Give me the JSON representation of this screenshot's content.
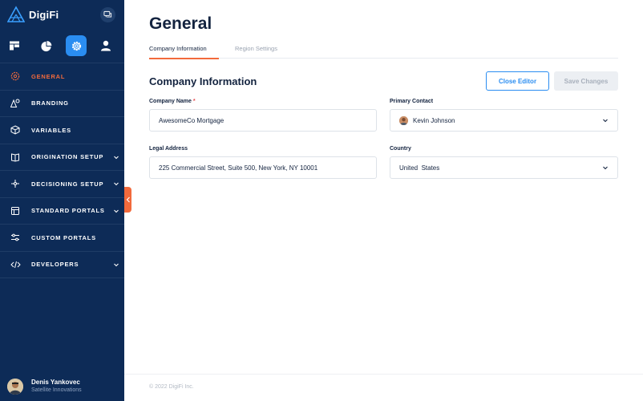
{
  "brand": {
    "name": "DigiFi"
  },
  "sidebar": {
    "topnav": [
      {
        "icon": "board-icon",
        "active": false
      },
      {
        "icon": "pie-chart-icon",
        "active": false
      },
      {
        "icon": "gear-icon",
        "active": true
      },
      {
        "icon": "user-icon",
        "active": false
      }
    ],
    "items": [
      {
        "label": "GENERAL",
        "icon": "gear-icon",
        "active": true,
        "expandable": false
      },
      {
        "label": "BRANDING",
        "icon": "shapes-icon",
        "active": false,
        "expandable": false
      },
      {
        "label": "VARIABLES",
        "icon": "cube-icon",
        "active": false,
        "expandable": false
      },
      {
        "label": "ORIGINATION SETUP",
        "icon": "book-icon",
        "active": false,
        "expandable": true
      },
      {
        "label": "DECISIONING SETUP",
        "icon": "flow-icon",
        "active": false,
        "expandable": true
      },
      {
        "label": "STANDARD PORTALS",
        "icon": "layout-icon",
        "active": false,
        "expandable": true
      },
      {
        "label": "CUSTOM PORTALS",
        "icon": "sliders-icon",
        "active": false,
        "expandable": false
      },
      {
        "label": "DEVELOPERS",
        "icon": "code-icon",
        "active": false,
        "expandable": true
      }
    ]
  },
  "user": {
    "name": "Denis Yankovec",
    "org": "Satellite Innovations"
  },
  "page": {
    "title": "General"
  },
  "tabs": [
    {
      "label": "Company Information",
      "active": true
    },
    {
      "label": "Region Settings",
      "active": false
    }
  ],
  "section": {
    "title": "Company Information",
    "close_label": "Close Editor",
    "save_label": "Save Changes"
  },
  "form": {
    "company_name": {
      "label": "Company Name",
      "required_mark": "*",
      "value": "AwesomeCo Mortgage"
    },
    "primary_contact": {
      "label": "Primary Contact",
      "value": "Kevin Johnson"
    },
    "legal_address": {
      "label": "Legal Address",
      "value": "225 Commercial Street, Suite 500, New York, NY 10001"
    },
    "country": {
      "label": "Country",
      "value": "United  States"
    }
  },
  "footer": {
    "copyright": "© 2022 DigiFi Inc."
  },
  "colors": {
    "sidebar": "#0d2b57",
    "accent": "#f26a3c",
    "primary": "#2a8df1"
  }
}
